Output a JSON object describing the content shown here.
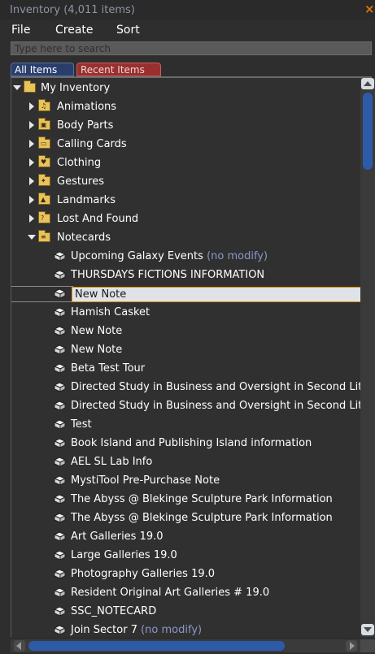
{
  "window": {
    "title": "Inventory (4,011 items)",
    "close_glyph": "×"
  },
  "menu": {
    "items": [
      "File",
      "Create",
      "Sort"
    ]
  },
  "search": {
    "placeholder": "Type here to search",
    "value": ""
  },
  "tabs": [
    {
      "label": "All Items",
      "active": true
    },
    {
      "label": "Recent Items",
      "active": false
    }
  ],
  "colors": {
    "accent_orange": "#e07800",
    "tab_active": "#2a3e6e",
    "tab_inactive": "#9a2f2f",
    "scroll_thumb": "#2d5ba8",
    "suffix_text": "#8b98c8"
  },
  "tree": {
    "root": {
      "label": "My Inventory",
      "icon": "folder-icon",
      "expanded": true
    },
    "folders": [
      {
        "label": "Animations",
        "icon": "animations-folder-icon",
        "expanded": false
      },
      {
        "label": "Body Parts",
        "icon": "body-parts-folder-icon",
        "expanded": false
      },
      {
        "label": "Calling Cards",
        "icon": "calling-cards-folder-icon",
        "expanded": false
      },
      {
        "label": "Clothing",
        "icon": "clothing-folder-icon",
        "expanded": false
      },
      {
        "label": "Gestures",
        "icon": "gestures-folder-icon",
        "expanded": false
      },
      {
        "label": "Landmarks",
        "icon": "landmarks-folder-icon",
        "expanded": false
      },
      {
        "label": "Lost And Found",
        "icon": "lost-and-found-folder-icon",
        "expanded": false
      },
      {
        "label": "Notecards",
        "icon": "notecards-folder-icon",
        "expanded": true
      }
    ],
    "notecards": [
      {
        "label": "Upcoming Galaxy Events",
        "suffix": "(no modify)"
      },
      {
        "label": "THURSDAYS FICTIONS INFORMATION",
        "suffix": ""
      },
      {
        "label": "New Note",
        "suffix": "",
        "renaming": true
      },
      {
        "label": "Hamish Casket",
        "suffix": ""
      },
      {
        "label": "New Note",
        "suffix": ""
      },
      {
        "label": "New Note",
        "suffix": ""
      },
      {
        "label": "Beta Test Tour",
        "suffix": ""
      },
      {
        "label": "Directed Study in Business and Oversight in Second Lit",
        "suffix": ""
      },
      {
        "label": "Directed Study in Business and Oversight in Second Lit",
        "suffix": ""
      },
      {
        "label": "Test",
        "suffix": ""
      },
      {
        "label": "Book Island and Publishing Island information",
        "suffix": ""
      },
      {
        "label": "AEL SL Lab Info",
        "suffix": ""
      },
      {
        "label": "MystiTool Pre-Purchase Note",
        "suffix": ""
      },
      {
        "label": "The Abyss @ Blekinge Sculpture Park Information",
        "suffix": ""
      },
      {
        "label": "The Abyss @ Blekinge Sculpture Park Information",
        "suffix": ""
      },
      {
        "label": "Art Galleries 19.0",
        "suffix": ""
      },
      {
        "label": "Large Galleries 19.0",
        "suffix": ""
      },
      {
        "label": "Photography Galleries 19.0",
        "suffix": ""
      },
      {
        "label": "Resident Original Art Galleries # 19.0",
        "suffix": ""
      },
      {
        "label": "SSC_NOTECARD",
        "suffix": ""
      },
      {
        "label": "Join Sector 7",
        "suffix": "(no modify)"
      }
    ]
  }
}
